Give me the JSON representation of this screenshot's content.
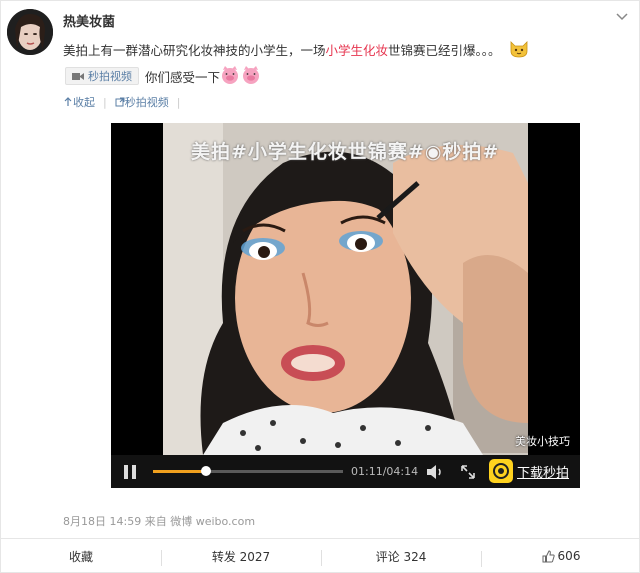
{
  "post": {
    "username": "热美妆菌",
    "text_before": "美拍上有一群潜心研究化妆神技的小学生，一场",
    "keyword": "小学生化妆",
    "text_after": "世锦赛已经引爆。。。",
    "video_tag": "秒拍视频",
    "line2": "你们感受一下"
  },
  "actions_top": {
    "collect": "收起",
    "video_link": "秒拍视频"
  },
  "video": {
    "banner": "美拍#小学生化妆世锦赛#◉秒拍#",
    "watermark": "美妆小技巧",
    "current_time": "01:11",
    "duration": "04:14",
    "progress": 0.28,
    "download_label": "下载秒拍"
  },
  "meta": {
    "date": "8月18日 14:59",
    "source_prefix": "来自",
    "source": "微博 weibo.com"
  },
  "bottom": {
    "favorite": "收藏",
    "repost": "转发 2027",
    "comment": "评论 324",
    "like": "606"
  },
  "colors": {
    "link": "#5b7fa6",
    "keyword": "#e6354f",
    "progress": "#f0a01e"
  }
}
